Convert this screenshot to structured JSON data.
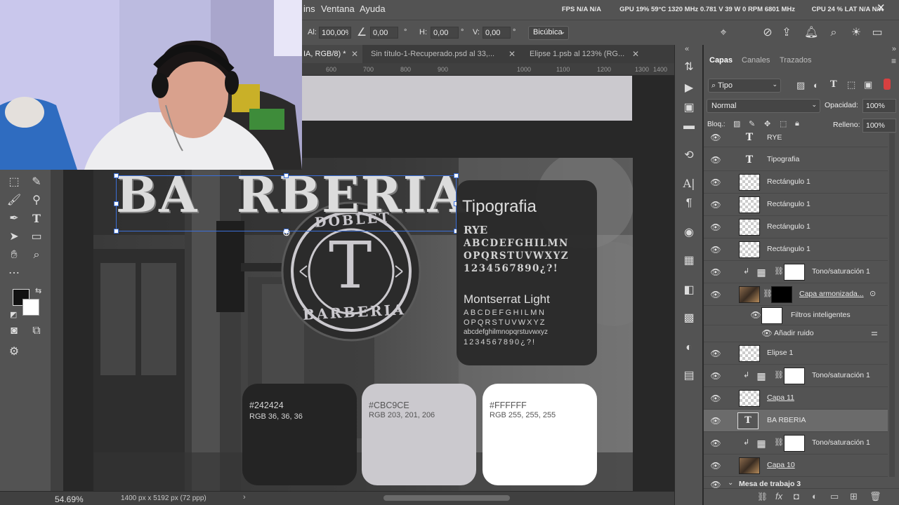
{
  "menu": {
    "items": [
      "ins",
      "Ventana",
      "Ayuda"
    ],
    "stats": [
      "FPS N/A N/A",
      "GPU 19% 59°C 1320 MHz 0.781 V 39 W 0 RPM 6801 MHz",
      "CPU 24 %"
    ],
    "lat_label": "LAT N/A N/A"
  },
  "options": {
    "al_label": "Al:",
    "al_value": "100,00%",
    "angle_value": "0,00",
    "h_label": "H:",
    "h_value": "0,00",
    "v_label": "V:",
    "v_value": "0,00",
    "deg": "°",
    "interpolation": "Bicúbica"
  },
  "tabs": [
    {
      "label": "IA, RGB/8) *",
      "active": true
    },
    {
      "label": "Sin título-1-Recuperado.psd al 33,...",
      "active": false
    },
    {
      "label": "Elipse 1.psb al 123% (RG...",
      "active": false
    }
  ],
  "ruler": {
    "ticks": [
      "600",
      "700",
      "800",
      "900",
      "1000",
      "1100",
      "1200",
      "1300",
      "1400"
    ]
  },
  "canvas": {
    "title_text": "BA RBERIA",
    "logo_top": "DOBLET",
    "logo_letter": "T",
    "logo_bottom": "BARBERIA",
    "typo_heading": "Tipografia",
    "font1_name": "RYE",
    "font1_line1": "ABCDEFGHILMN",
    "font1_line2": "OPQRSTUVWXYZ",
    "font1_line3": "1234567890¿?!",
    "font2_name": "Montserrat Light",
    "font2_line1": "ABCDEFGHILMN",
    "font2_line2": "OPQRSTUVWXYZ",
    "font2_line3": "abcdefghilmnopqrstuvwxyz",
    "font2_line4": "1234567890¿?!",
    "swatches": [
      {
        "hex": "#242424",
        "rgb": "RGB 36, 36, 36",
        "color": "#242424",
        "text_color": "#d6d6d6"
      },
      {
        "hex": "#CBC9CE",
        "rgb": "RGB 203, 201, 206",
        "color": "#cbc9ce",
        "text_color": "#555555"
      },
      {
        "hex": "#FFFFFF",
        "rgb": "RGB 255, 255, 255",
        "color": "#ffffff",
        "text_color": "#555555"
      }
    ]
  },
  "status": {
    "zoom": "54.69%",
    "doc_size": "1400 px x 5192 px (72 ppp)"
  },
  "panel": {
    "tabs": [
      "Capas",
      "Canales",
      "Trazados"
    ],
    "filter_kind": "Tipo",
    "blend_mode": "Normal",
    "opacity_label": "Opacidad:",
    "opacity_value": "100%",
    "lock_label": "Bloq.:",
    "fill_label": "Relleno:",
    "fill_value": "100%"
  },
  "layers": [
    {
      "name": "RYE",
      "thumb": "text",
      "indent": false
    },
    {
      "name": "Tipografia",
      "thumb": "text",
      "indent": false
    },
    {
      "name": "Rectángulo 1",
      "thumb": "checker",
      "indent": false
    },
    {
      "name": "Rectángulo 1",
      "thumb": "checker",
      "indent": false
    },
    {
      "name": "Rectángulo 1",
      "thumb": "checker",
      "indent": false
    },
    {
      "name": "Rectángulo 1",
      "thumb": "checker",
      "indent": false
    },
    {
      "name": "Tono/saturación 1",
      "thumb": "adj",
      "indent": true
    },
    {
      "name": "Capa armonizada...",
      "thumb": "photo",
      "indent": false
    },
    {
      "name": "Filtros inteligentes",
      "thumb": "white",
      "indent": true
    },
    {
      "name": "Añadir ruido",
      "thumb": "none",
      "indent": true
    },
    {
      "name": "Elipse 1",
      "thumb": "checker",
      "indent": false
    },
    {
      "name": "Tono/saturación 1",
      "thumb": "adj",
      "indent": true
    },
    {
      "name": "Capa 11",
      "thumb": "checker",
      "indent": false
    },
    {
      "name": "BA RBERIA",
      "thumb": "text",
      "indent": false
    },
    {
      "name": "Tono/saturación 1",
      "thumb": "adj",
      "indent": true
    },
    {
      "name": "Capa 10",
      "thumb": "photo",
      "indent": false
    },
    {
      "name": "Mesa de trabajo 3",
      "thumb": "group",
      "indent": false
    }
  ],
  "colors": {
    "accent": "#cbc9ce",
    "dark": "#242424",
    "panel_bg": "#535353"
  }
}
